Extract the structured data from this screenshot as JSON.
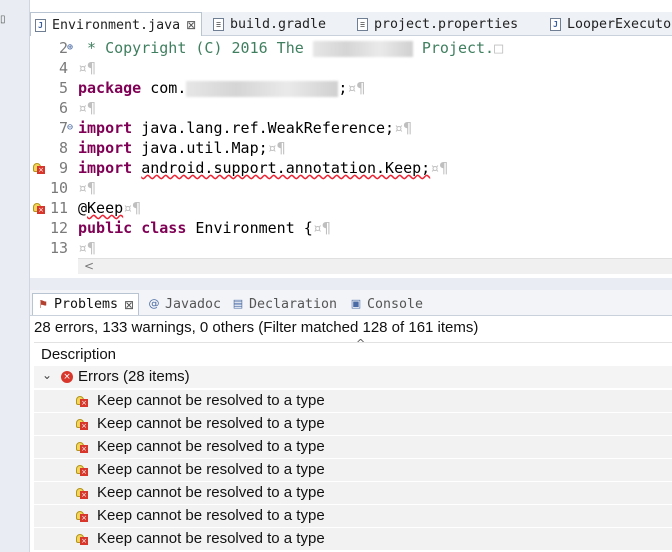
{
  "editor_tabs": [
    {
      "label": "Environment.java",
      "close": "⊠",
      "icon": "java-file-icon"
    },
    {
      "label": "build.gradle",
      "icon": "gradle-file-icon"
    },
    {
      "label": "project.properties",
      "icon": "properties-file-icon"
    },
    {
      "label": "LooperExecuto",
      "icon": "java-file-icon"
    }
  ],
  "editor": {
    "lines": [
      {
        "num": "2",
        "fold": "⊕",
        "parts": [
          {
            "t": " * Copyright (C) 2016 The ",
            "c": "cm"
          },
          {
            "redact": true,
            "w": 100
          },
          {
            "t": " Project.",
            "c": "cm"
          },
          {
            "t": "□",
            "c": "ws"
          }
        ]
      },
      {
        "num": "4",
        "parts": [
          {
            "t": "¤¶",
            "c": "ws"
          }
        ]
      },
      {
        "num": "5",
        "parts": [
          {
            "t": "package",
            "c": "kw"
          },
          {
            "t": " com."
          },
          {
            "redact": true,
            "w": 152
          },
          {
            "t": ";"
          },
          {
            "t": "¤¶",
            "c": "ws"
          }
        ]
      },
      {
        "num": "6",
        "parts": [
          {
            "t": "¤¶",
            "c": "ws"
          }
        ]
      },
      {
        "num": "7",
        "fold": "⊖",
        "parts": [
          {
            "t": "import",
            "c": "kw"
          },
          {
            "t": " java.lang.ref.WeakReference;"
          },
          {
            "t": "¤¶",
            "c": "ws"
          }
        ]
      },
      {
        "num": "8",
        "parts": [
          {
            "t": "import",
            "c": "kw"
          },
          {
            "t": " java.util.Map;"
          },
          {
            "t": "¤¶",
            "c": "ws"
          }
        ]
      },
      {
        "num": "9",
        "marker": true,
        "parts": [
          {
            "t": "import",
            "c": "kw"
          },
          {
            "t": " "
          },
          {
            "t": "android.support.annotation.Keep;",
            "c": "err"
          },
          {
            "t": "¤¶",
            "c": "ws"
          }
        ]
      },
      {
        "num": "10",
        "parts": [
          {
            "t": "¤¶",
            "c": "ws"
          }
        ]
      },
      {
        "num": "11",
        "marker": true,
        "parts": [
          {
            "t": "@"
          },
          {
            "t": "Keep",
            "c": "err"
          },
          {
            "t": "¤¶",
            "c": "ws"
          }
        ]
      },
      {
        "num": "12",
        "parts": [
          {
            "t": "public",
            "c": "kw"
          },
          {
            "t": " "
          },
          {
            "t": "class",
            "c": "kw"
          },
          {
            "t": " Environment {"
          },
          {
            "t": "¤¶",
            "c": "ws"
          }
        ]
      },
      {
        "num": "13",
        "parts": [
          {
            "t": "¤¶",
            "c": "ws"
          }
        ]
      }
    ],
    "scroll_glyph": "<"
  },
  "view_tabs": [
    {
      "label": "Problems",
      "close": "⊠",
      "icon": "problems-icon",
      "glyph": "⚑"
    },
    {
      "label": "Javadoc",
      "icon": "javadoc-icon",
      "glyph": "@"
    },
    {
      "label": "Declaration",
      "icon": "declaration-icon",
      "glyph": "▤"
    },
    {
      "label": "Console",
      "icon": "console-icon",
      "glyph": "▣"
    }
  ],
  "problems": {
    "summary": "28 errors, 133 warnings, 0 others (Filter matched 128 of 161 items)",
    "column_description": "Description",
    "sort_glyph": "^",
    "group_chevron": "⌄",
    "group_glyph": "×",
    "group_label": "Errors (28 items)",
    "rows": [
      "Keep cannot be resolved to a type",
      "Keep cannot be resolved to a type",
      "Keep cannot be resolved to a type",
      "Keep cannot be resolved to a type",
      "Keep cannot be resolved to a type",
      "Keep cannot be resolved to a type",
      "Keep cannot be resolved to a type"
    ]
  },
  "colors": {
    "keyword": "#7f0055",
    "comment": "#3f7f5f",
    "error": "#d9362b",
    "whitespace_marker": "#bfbfbf"
  }
}
